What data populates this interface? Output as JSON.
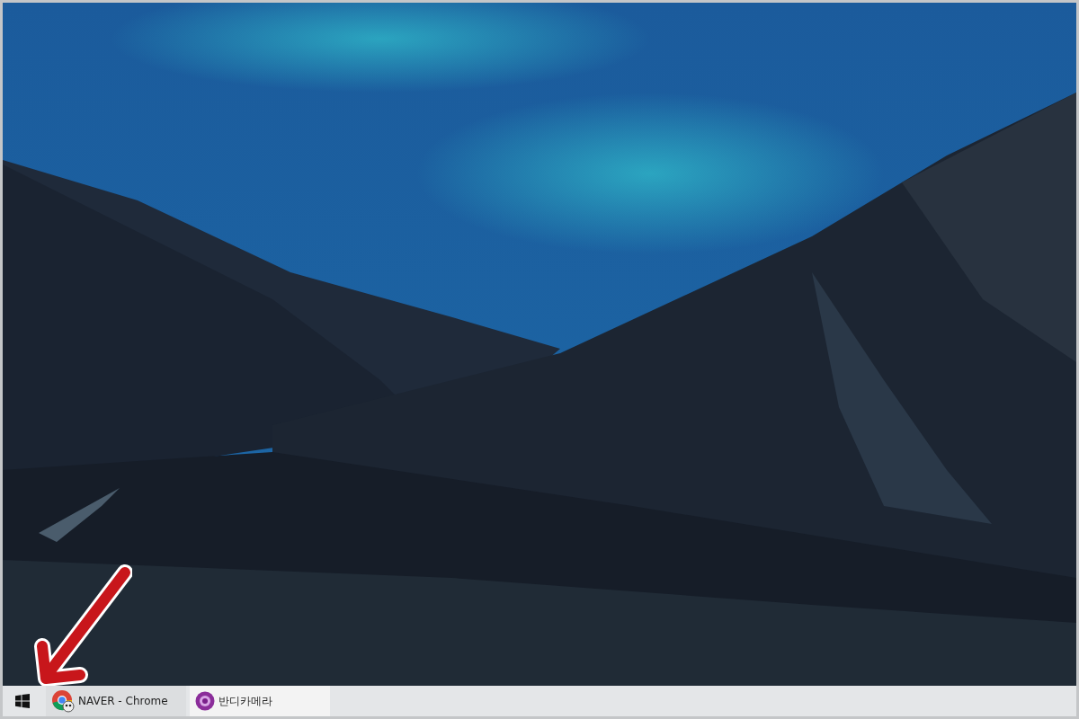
{
  "annotation": {
    "kind": "arrow"
  },
  "taskbar": {
    "items": [
      {
        "label": "NAVER - Chrome",
        "kind": "browser",
        "selected": false
      },
      {
        "label": "반디카메라",
        "kind": "camera",
        "selected": true
      }
    ]
  }
}
